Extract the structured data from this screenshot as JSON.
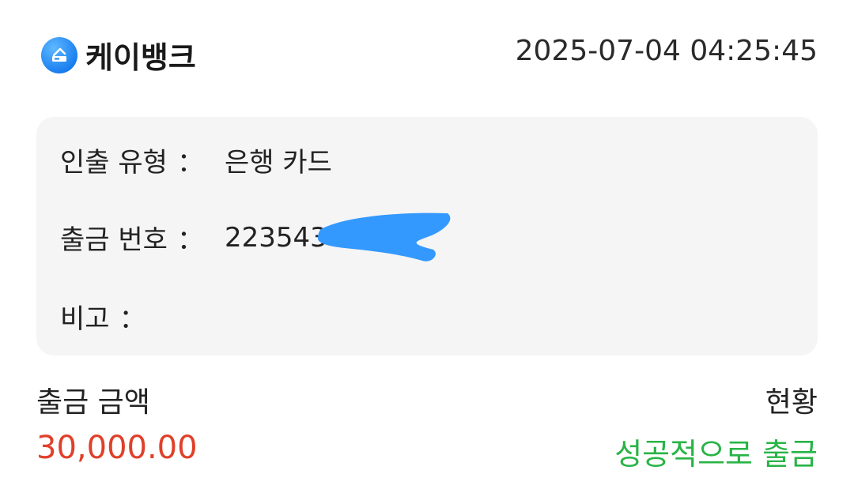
{
  "header": {
    "brand_name": "케이뱅크",
    "logo_icon": "kbank-logo-icon",
    "datetime": "2025-07-04 04:25:45"
  },
  "details": {
    "withdraw_type_label": "인출 유형",
    "withdraw_type_value": "은행 카드",
    "withdraw_number_label": "출금 번호",
    "withdraw_number_value": "223543",
    "memo_label": "비고",
    "memo_value": "",
    "separator": "："
  },
  "summary": {
    "amount_label": "출금 금액",
    "amount_value": "30,000.00",
    "status_label": "현황",
    "status_value": "성공적으로 출금"
  },
  "colors": {
    "amount": "#e0402a",
    "status": "#28b446",
    "logo": "#1a7ff0",
    "redaction": "#3399ff",
    "card_bg": "#f5f5f5"
  }
}
